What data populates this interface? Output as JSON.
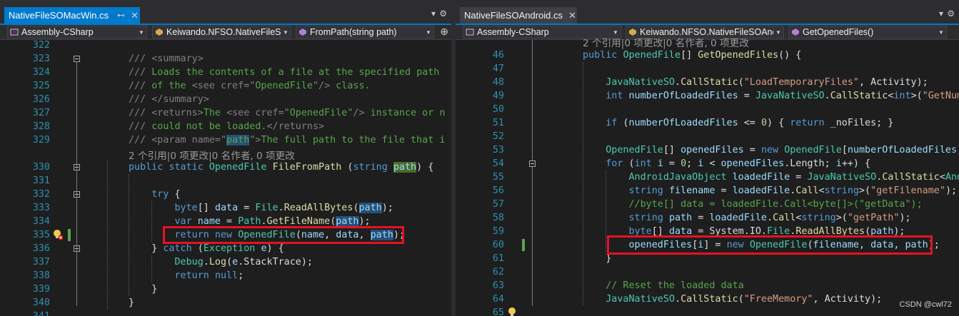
{
  "left": {
    "tab": {
      "title": "NativeFileSOMacWin.cs",
      "pin": "⊷",
      "close": "✕"
    },
    "nav": {
      "project": "Assembly-CSharp",
      "klass": "Keiwando.NFSO.NativeFileS(",
      "member": "FromPath(string path)"
    },
    "code_lens": "2 个引用|0 项更改|0 名作者, 0 项更改",
    "lines": [
      {
        "n": "322",
        "html": ""
      },
      {
        "n": "323",
        "html": "<span class=\"x\">///</span><span class=\"c\"> </span><span class=\"x\">&lt;summary&gt;</span>"
      },
      {
        "n": "324",
        "html": "<span class=\"x\">///</span><span class=\"c\"> Loads the contents of a file at the specified path</span>"
      },
      {
        "n": "325",
        "html": "<span class=\"x\">///</span><span class=\"c\"> of the </span><span class=\"x\">&lt;see </span><span class=\"x\">cref=</span><span class=\"x\">\"</span><span class=\"c\">OpenedFile</span><span class=\"x\">\"/&gt;</span><span class=\"c\"> class.</span>"
      },
      {
        "n": "326",
        "html": "<span class=\"x\">/// &lt;/summary&gt;</span>"
      },
      {
        "n": "327",
        "html": "<span class=\"x\">/// &lt;returns&gt;</span><span class=\"c\">The </span><span class=\"x\">&lt;see cref=\"</span><span class=\"c\">OpenedFile</span><span class=\"x\">\"/&gt;</span><span class=\"c\"> instance or n</span>"
      },
      {
        "n": "328",
        "html": "<span class=\"x\">///</span><span class=\"c\"> could not be loaded.</span><span class=\"x\">&lt;/returns&gt;</span>"
      },
      {
        "n": "329",
        "html": "<span class=\"x\">/// &lt;param name=\"</span><span class=\"c hl\">path</span><span class=\"x\">\"&gt;</span><span class=\"c\">The full path to the file that i</span>"
      },
      {
        "n": "330",
        "html": "<span class=\"k\">public</span> <span class=\"k\">static</span> <span class=\"t\">OpenedFile</span> <span class=\"m\">FileFromPath</span> (<span class=\"k\">string</span> <span class=\"p hlg\">path</span>) {"
      },
      {
        "n": "331",
        "html": ""
      },
      {
        "n": "332",
        "html": "    <span class=\"k\">try</span> {"
      },
      {
        "n": "333",
        "html": "        <span class=\"k\">byte</span>[] <span class=\"p\">data</span> = <span class=\"t\">File</span>.<span class=\"m\">ReadAllBytes</span>(<span class=\"p hl\">path</span>);"
      },
      {
        "n": "334",
        "html": "        <span class=\"k\">var</span> <span class=\"p\">name</span> = <span class=\"t\">Path</span>.<span class=\"m\">GetFileName</span>(<span class=\"p hl\">path</span>);"
      },
      {
        "n": "335",
        "html": "        <span class=\"k\">return</span> <span class=\"k\">new</span> <span class=\"t\">OpenedFile</span>(<span class=\"p\">name</span>, <span class=\"p\">data</span>, <span class=\"p hl\">path</span>);"
      },
      {
        "n": "336",
        "html": "    } <span class=\"k\">catch</span> (<span class=\"t\">Exception</span> <span class=\"p\">e</span>) {"
      },
      {
        "n": "337",
        "html": "        <span class=\"t\">Debug</span>.<span class=\"m\">Log</span>(<span class=\"p\">e</span>.StackTrace);"
      },
      {
        "n": "338",
        "html": "        <span class=\"k\">return</span> <span class=\"k\">null</span>;"
      },
      {
        "n": "339",
        "html": "    }"
      },
      {
        "n": "340",
        "html": "}"
      },
      {
        "n": "341",
        "html": ""
      }
    ]
  },
  "right": {
    "tab": {
      "title": "NativeFileSOAndroid.cs",
      "close": "✕"
    },
    "nav": {
      "project": "Assembly-CSharp",
      "klass": "Keiwando.NFSO.NativeFileSOAnd",
      "member": "GetOpenedFiles()"
    },
    "code_lens": "2 个引用|0 项更改|0 名作者, 0 项更改",
    "lines": [
      {
        "n": "46",
        "html": "<span class=\"k\">public</span> <span class=\"t\">OpenedFile</span>[] <span class=\"m\">GetOpenedFiles</span>() {"
      },
      {
        "n": "47",
        "html": ""
      },
      {
        "n": "48",
        "html": "    <span class=\"t\">JavaNativeSO</span>.<span class=\"m\">CallStatic</span>(<span class=\"s\">\"LoadTemporaryFiles\"</span>, Activity);"
      },
      {
        "n": "49",
        "html": "    <span class=\"k\">int</span> <span class=\"p\">numberOfLoadedFiles</span> = <span class=\"t\">JavaNativeSO</span>.<span class=\"m\">CallStatic</span>&lt;<span class=\"k\">int</span>&gt;(<span class=\"s\">\"GetNum</span>"
      },
      {
        "n": "50",
        "html": ""
      },
      {
        "n": "51",
        "html": "    <span class=\"k\">if</span> (<span class=\"p\">numberOfLoadedFiles</span> &lt;= <span class=\"n\">0</span>) { <span class=\"k\">return</span> _noFiles; }"
      },
      {
        "n": "52",
        "html": ""
      },
      {
        "n": "53",
        "html": "    <span class=\"t\">OpenedFile</span>[] <span class=\"p\">openedFiles</span> = <span class=\"k\">new</span> <span class=\"t\">OpenedFile</span>[<span class=\"p\">numberOfLoadedFiles</span>]"
      },
      {
        "n": "54",
        "html": "    <span class=\"k\">for</span> (<span class=\"k\">int</span> <span class=\"p\">i</span> = <span class=\"n\">0</span>; <span class=\"p\">i</span> &lt; <span class=\"p\">openedFiles</span>.Length; <span class=\"p\">i</span>++) {"
      },
      {
        "n": "55",
        "html": "        <span class=\"t\">AndroidJavaObject</span> <span class=\"p\">loadedFile</span> = <span class=\"t\">JavaNativeSO</span>.<span class=\"m\">CallStatic</span>&lt;<span class=\"t\">And</span>"
      },
      {
        "n": "56",
        "html": "        <span class=\"k\">string</span> <span class=\"p\">filename</span> = <span class=\"p\">loadedFile</span>.<span class=\"m\">Call</span>&lt;<span class=\"k\">string</span>&gt;(<span class=\"s\">\"getFilename\"</span>);"
      },
      {
        "n": "57",
        "html": "        <span class=\"c\">//byte[] data = loadedFile.Call&lt;byte[]&gt;(\"getData\");</span>"
      },
      {
        "n": "58",
        "html": "        <span class=\"k\">string</span> <span class=\"p\">path</span> = <span class=\"p\">loadedFile</span>.<span class=\"m\">Call</span>&lt;<span class=\"k\">string</span>&gt;(<span class=\"s\">\"getPath\"</span>);"
      },
      {
        "n": "59",
        "html": "        <span class=\"k\">byte</span>[] <span class=\"p\">data</span> = System.IO.<span class=\"t\">File</span>.<span class=\"m\">ReadAllBytes</span>(<span class=\"p\">path</span>);"
      },
      {
        "n": "60",
        "html": "        <span class=\"p\">openedFiles</span>[<span class=\"p\">i</span>] = <span class=\"k\">new</span> <span class=\"t\">OpenedFile</span>(<span class=\"p\">filename</span>, <span class=\"p\">data</span>, <span class=\"p\">path</span>);"
      },
      {
        "n": "61",
        "html": "    }"
      },
      {
        "n": "62",
        "html": ""
      },
      {
        "n": "63",
        "html": "    <span class=\"c\">// Reset the loaded data</span>"
      },
      {
        "n": "64",
        "html": "    <span class=\"t\">JavaNativeSO</span>.<span class=\"m\">CallStatic</span>(<span class=\"s\">\"FreeMemory\"</span>, Activity);"
      },
      {
        "n": "65",
        "html": ""
      }
    ]
  },
  "watermark": "CSDN @cwl72",
  "colors": {
    "accent": "#007acc",
    "highlight_box": "#e81123"
  }
}
